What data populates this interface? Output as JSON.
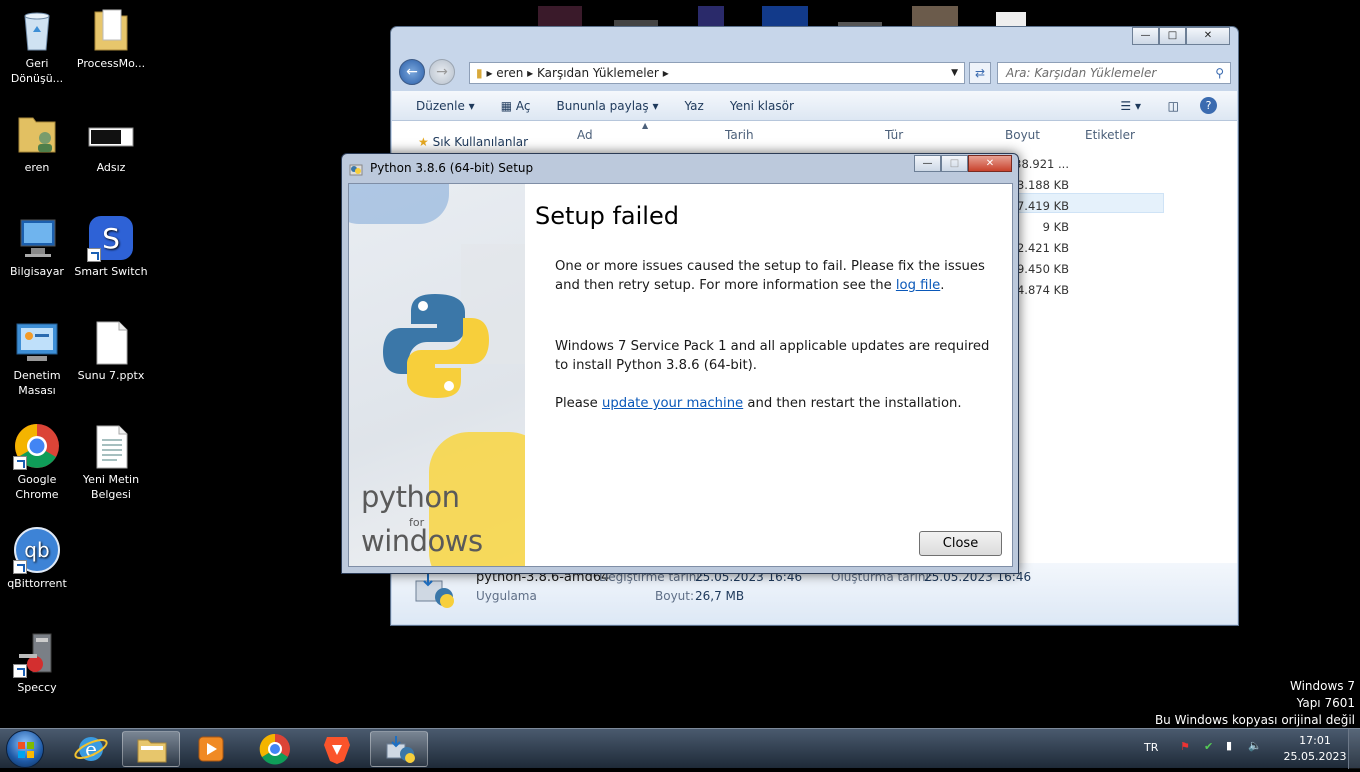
{
  "desktop_icons": [
    {
      "label": "Geri Dönüşü...",
      "icon": "recycle-bin-icon"
    },
    {
      "label": "ProcessMo...",
      "icon": "folder-icon"
    },
    {
      "label": "eren",
      "icon": "user-folder-icon"
    },
    {
      "label": "Adsız",
      "icon": "monitor-icon"
    },
    {
      "label": "Bilgisayar",
      "icon": "computer-icon"
    },
    {
      "label": "Smart Switch",
      "icon": "smart-switch-icon"
    },
    {
      "label": "Denetim Masası",
      "icon": "control-panel-icon"
    },
    {
      "label": "Sunu 7.pptx",
      "icon": "document-icon"
    },
    {
      "label": "Google Chrome",
      "icon": "chrome-icon"
    },
    {
      "label": "Yeni Metin Belgesi",
      "icon": "text-document-icon"
    },
    {
      "label": "qBittorrent",
      "icon": "qbittorrent-icon"
    },
    {
      "label": "Speccy",
      "icon": "speccy-icon"
    }
  ],
  "explorer": {
    "breadcrumb": [
      "eren",
      "Karşıdan Yüklemeler"
    ],
    "search_placeholder": "Ara: Karşıdan Yüklemeler",
    "toolbar": {
      "organize": "Düzenle",
      "open": "Aç",
      "share": "Bununla paylaş",
      "print": "Yaz",
      "new_folder": "Yeni klasör"
    },
    "nav_favorites": "Sık Kullanılanlar",
    "columns": {
      "name": "Ad",
      "date": "Tarih",
      "type": "Tür",
      "size": "Boyut",
      "tags": "Etiketler"
    },
    "sizes": [
      "938.921 ...",
      "73.188 KB",
      "27.419 KB",
      "9 KB",
      "52.421 KB",
      "9.450 KB",
      "24.874 KB"
    ],
    "details": {
      "filename": "python-3.8.6-amd64",
      "modified_label": "Değiştirme tarihi:",
      "modified_value": "25.05.2023 16:46",
      "created_label": "Oluşturma tarihi:",
      "created_value": "25.05.2023 16:46",
      "kind": "Uygulama",
      "size_label": "Boyut:",
      "size_value": "26,7 MB"
    }
  },
  "dialog": {
    "title": "Python 3.8.6 (64-bit) Setup",
    "heading": "Setup failed",
    "para1_text": "One or more issues caused the setup to fail. Please fix the issues and then retry setup. For more information see the ",
    "para1_link": "log file",
    "para1_end": ".",
    "para2": "Windows 7 Service Pack 1 and all applicable updates are required to install Python 3.8.6 (64-bit).",
    "para3_start": "Please ",
    "para3_link": "update your machine",
    "para3_end": " and then restart the installation.",
    "brand_line1": "python",
    "brand_line2": "for",
    "brand_line3": "windows",
    "close_button": "Close"
  },
  "tray": {
    "language": "TR",
    "time": "17:01",
    "date": "25.05.2023"
  },
  "watermark": {
    "line1": "Windows 7",
    "line2": "Yapı 7601",
    "line3": "Bu Windows kopyası orijinal değil"
  },
  "colors": {
    "link": "#0a58b9",
    "taskbar": "#2b3a4c",
    "dialog_frame": "#bcc9dc"
  }
}
